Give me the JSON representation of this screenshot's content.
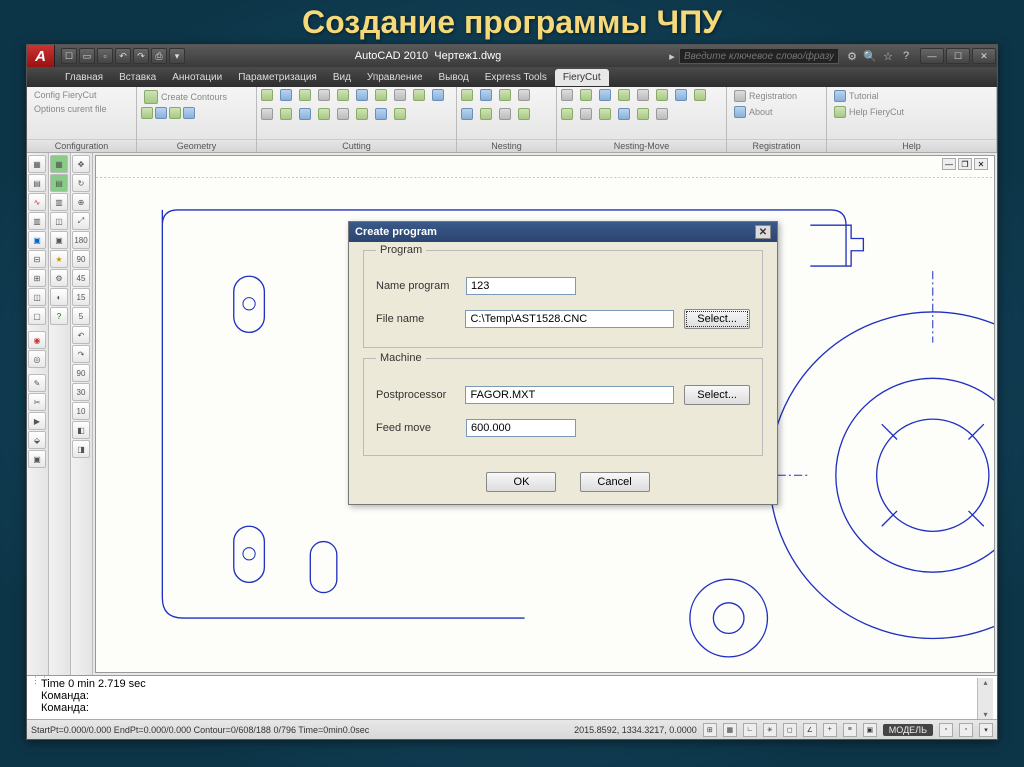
{
  "slide_title": "Создание программы ЧПУ",
  "titlebar": {
    "app": "AutoCAD 2010",
    "file": "Чертеж1.dwg",
    "search_ph": "Введите ключевое слово/фразу"
  },
  "menutabs": [
    "Главная",
    "Вставка",
    "Аннотации",
    "Параметризация",
    "Вид",
    "Управление",
    "Вывод",
    "Express Tools",
    "FieryCut"
  ],
  "menutabs_active": 8,
  "ribbon": {
    "groups": [
      {
        "label": "Configuration",
        "items": [
          "Config FieryCut",
          "Options curent file"
        ]
      },
      {
        "label": "Geometry",
        "items": [
          "Create Contours"
        ]
      },
      {
        "label": "Cutting"
      },
      {
        "label": "Nesting"
      },
      {
        "label": "Nesting-Move"
      },
      {
        "label": "Registration",
        "items": [
          "Registration",
          "About"
        ]
      },
      {
        "label": "Help",
        "items": [
          "Tutorial",
          "Help FieryCut"
        ]
      }
    ]
  },
  "dialog": {
    "title": "Create program",
    "group1": "Program",
    "name_label": "Name program",
    "name_val": "123",
    "file_label": "File name",
    "file_val": "C:\\Temp\\AST1528.CNC",
    "group2": "Machine",
    "post_label": "Postprocessor",
    "post_val": "FAGOR.MXT",
    "feed_label": "Feed move",
    "feed_val": "600.000",
    "select": "Select...",
    "ok": "OK",
    "cancel": "Cancel"
  },
  "cmd": {
    "l1": "Time  0 min 2.719 sec",
    "l2": "Команда:",
    "l3": "Команда:"
  },
  "status": {
    "left": "StartPt=0.000/0.000  EndPt=0.000/0.000  Contour=0/608/188  0/796  Time=0min0.0sec",
    "coords": "2015.8592, 1334.3217, 0.0000",
    "model": "МОДЕЛЬ"
  }
}
